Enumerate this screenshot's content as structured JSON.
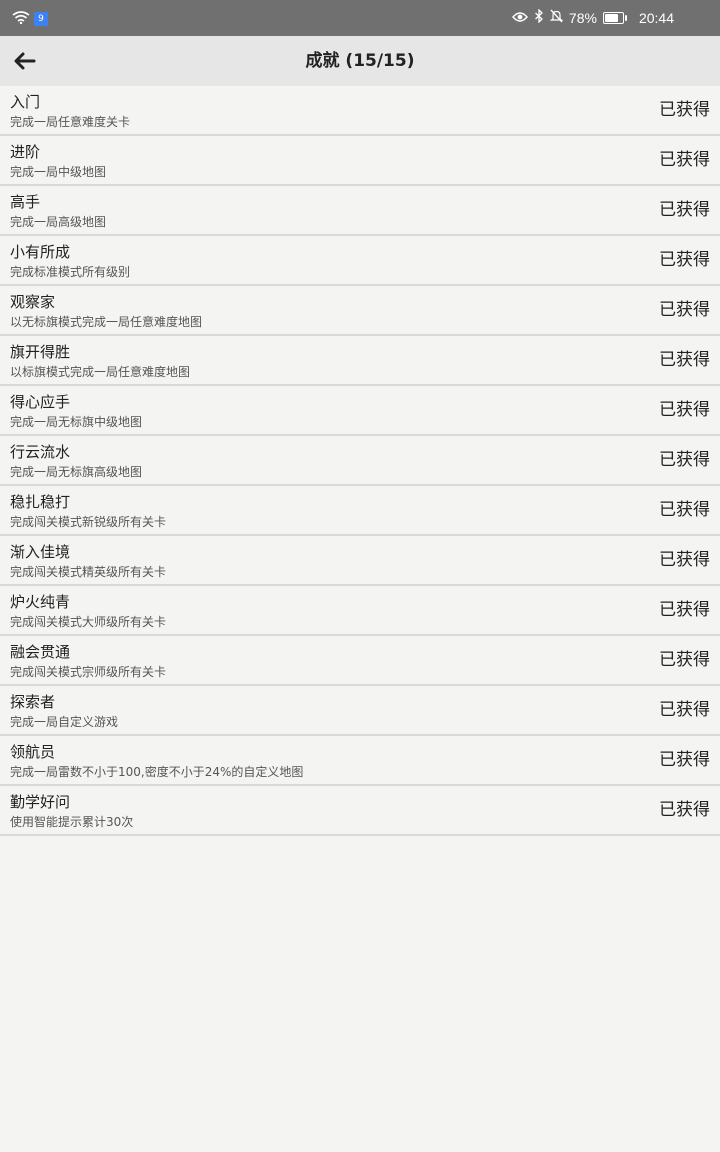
{
  "status_bar": {
    "hd_badge": "9",
    "battery": "78%",
    "battery_level": 0.78,
    "time": "20:44",
    "icons": [
      "wifi-icon",
      "hd-badge-icon",
      "eye-icon",
      "bluetooth-icon",
      "bell-muted-icon",
      "battery-icon"
    ]
  },
  "header": {
    "title": "成就 (15/15)",
    "back_icon": "arrow-left-icon"
  },
  "achievements": [
    {
      "title": "入门",
      "desc": "完成一局任意难度关卡",
      "status": "已获得"
    },
    {
      "title": "进阶",
      "desc": "完成一局中级地图",
      "status": "已获得"
    },
    {
      "title": "高手",
      "desc": "完成一局高级地图",
      "status": "已获得"
    },
    {
      "title": "小有所成",
      "desc": "完成标准模式所有级别",
      "status": "已获得"
    },
    {
      "title": "观察家",
      "desc": "以无标旗模式完成一局任意难度地图",
      "status": "已获得"
    },
    {
      "title": "旗开得胜",
      "desc": "以标旗模式完成一局任意难度地图",
      "status": "已获得"
    },
    {
      "title": "得心应手",
      "desc": "完成一局无标旗中级地图",
      "status": "已获得"
    },
    {
      "title": "行云流水",
      "desc": "完成一局无标旗高级地图",
      "status": "已获得"
    },
    {
      "title": "稳扎稳打",
      "desc": "完成闯关模式新锐级所有关卡",
      "status": "已获得"
    },
    {
      "title": "渐入佳境",
      "desc": "完成闯关模式精英级所有关卡",
      "status": "已获得"
    },
    {
      "title": "炉火纯青",
      "desc": "完成闯关模式大师级所有关卡",
      "status": "已获得"
    },
    {
      "title": "融会贯通",
      "desc": "完成闯关模式宗师级所有关卡",
      "status": "已获得"
    },
    {
      "title": "探索者",
      "desc": "完成一局自定义游戏",
      "status": "已获得"
    },
    {
      "title": "领航员",
      "desc": "完成一局雷数不小于100,密度不小于24%的自定义地图",
      "status": "已获得"
    },
    {
      "title": "勤学好问",
      "desc": "使用智能提示累计30次",
      "status": "已获得"
    }
  ]
}
